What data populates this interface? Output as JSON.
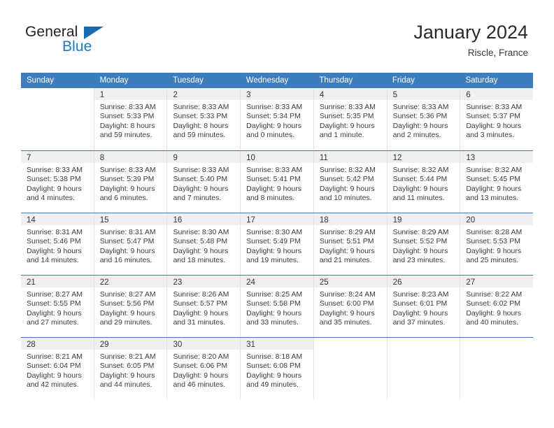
{
  "brand": {
    "name_part1": "General",
    "name_part2": "Blue",
    "triangle_color": "#1b6bb0",
    "blue_color": "#1f78c1"
  },
  "header": {
    "title": "January 2024",
    "location": "Riscle, France"
  },
  "theme": {
    "header_row_bg": "#3b7dbd",
    "day_number_bg": "#f0f0f0",
    "week_divider": "#3b7dbd",
    "column_divider": "#e3e3e3"
  },
  "weekday_headers": [
    "Sunday",
    "Monday",
    "Tuesday",
    "Wednesday",
    "Thursday",
    "Friday",
    "Saturday"
  ],
  "weeks": [
    [
      {
        "day": "",
        "sunrise": "",
        "sunset": "",
        "daylight_line1": "",
        "daylight_line2": ""
      },
      {
        "day": "1",
        "sunrise": "Sunrise: 8:33 AM",
        "sunset": "Sunset: 5:33 PM",
        "daylight_line1": "Daylight: 8 hours",
        "daylight_line2": "and 59 minutes."
      },
      {
        "day": "2",
        "sunrise": "Sunrise: 8:33 AM",
        "sunset": "Sunset: 5:33 PM",
        "daylight_line1": "Daylight: 8 hours",
        "daylight_line2": "and 59 minutes."
      },
      {
        "day": "3",
        "sunrise": "Sunrise: 8:33 AM",
        "sunset": "Sunset: 5:34 PM",
        "daylight_line1": "Daylight: 9 hours",
        "daylight_line2": "and 0 minutes."
      },
      {
        "day": "4",
        "sunrise": "Sunrise: 8:33 AM",
        "sunset": "Sunset: 5:35 PM",
        "daylight_line1": "Daylight: 9 hours",
        "daylight_line2": "and 1 minute."
      },
      {
        "day": "5",
        "sunrise": "Sunrise: 8:33 AM",
        "sunset": "Sunset: 5:36 PM",
        "daylight_line1": "Daylight: 9 hours",
        "daylight_line2": "and 2 minutes."
      },
      {
        "day": "6",
        "sunrise": "Sunrise: 8:33 AM",
        "sunset": "Sunset: 5:37 PM",
        "daylight_line1": "Daylight: 9 hours",
        "daylight_line2": "and 3 minutes."
      }
    ],
    [
      {
        "day": "7",
        "sunrise": "Sunrise: 8:33 AM",
        "sunset": "Sunset: 5:38 PM",
        "daylight_line1": "Daylight: 9 hours",
        "daylight_line2": "and 4 minutes."
      },
      {
        "day": "8",
        "sunrise": "Sunrise: 8:33 AM",
        "sunset": "Sunset: 5:39 PM",
        "daylight_line1": "Daylight: 9 hours",
        "daylight_line2": "and 6 minutes."
      },
      {
        "day": "9",
        "sunrise": "Sunrise: 8:33 AM",
        "sunset": "Sunset: 5:40 PM",
        "daylight_line1": "Daylight: 9 hours",
        "daylight_line2": "and 7 minutes."
      },
      {
        "day": "10",
        "sunrise": "Sunrise: 8:33 AM",
        "sunset": "Sunset: 5:41 PM",
        "daylight_line1": "Daylight: 9 hours",
        "daylight_line2": "and 8 minutes."
      },
      {
        "day": "11",
        "sunrise": "Sunrise: 8:32 AM",
        "sunset": "Sunset: 5:42 PM",
        "daylight_line1": "Daylight: 9 hours",
        "daylight_line2": "and 10 minutes."
      },
      {
        "day": "12",
        "sunrise": "Sunrise: 8:32 AM",
        "sunset": "Sunset: 5:44 PM",
        "daylight_line1": "Daylight: 9 hours",
        "daylight_line2": "and 11 minutes."
      },
      {
        "day": "13",
        "sunrise": "Sunrise: 8:32 AM",
        "sunset": "Sunset: 5:45 PM",
        "daylight_line1": "Daylight: 9 hours",
        "daylight_line2": "and 13 minutes."
      }
    ],
    [
      {
        "day": "14",
        "sunrise": "Sunrise: 8:31 AM",
        "sunset": "Sunset: 5:46 PM",
        "daylight_line1": "Daylight: 9 hours",
        "daylight_line2": "and 14 minutes."
      },
      {
        "day": "15",
        "sunrise": "Sunrise: 8:31 AM",
        "sunset": "Sunset: 5:47 PM",
        "daylight_line1": "Daylight: 9 hours",
        "daylight_line2": "and 16 minutes."
      },
      {
        "day": "16",
        "sunrise": "Sunrise: 8:30 AM",
        "sunset": "Sunset: 5:48 PM",
        "daylight_line1": "Daylight: 9 hours",
        "daylight_line2": "and 18 minutes."
      },
      {
        "day": "17",
        "sunrise": "Sunrise: 8:30 AM",
        "sunset": "Sunset: 5:49 PM",
        "daylight_line1": "Daylight: 9 hours",
        "daylight_line2": "and 19 minutes."
      },
      {
        "day": "18",
        "sunrise": "Sunrise: 8:29 AM",
        "sunset": "Sunset: 5:51 PM",
        "daylight_line1": "Daylight: 9 hours",
        "daylight_line2": "and 21 minutes."
      },
      {
        "day": "19",
        "sunrise": "Sunrise: 8:29 AM",
        "sunset": "Sunset: 5:52 PM",
        "daylight_line1": "Daylight: 9 hours",
        "daylight_line2": "and 23 minutes."
      },
      {
        "day": "20",
        "sunrise": "Sunrise: 8:28 AM",
        "sunset": "Sunset: 5:53 PM",
        "daylight_line1": "Daylight: 9 hours",
        "daylight_line2": "and 25 minutes."
      }
    ],
    [
      {
        "day": "21",
        "sunrise": "Sunrise: 8:27 AM",
        "sunset": "Sunset: 5:55 PM",
        "daylight_line1": "Daylight: 9 hours",
        "daylight_line2": "and 27 minutes."
      },
      {
        "day": "22",
        "sunrise": "Sunrise: 8:27 AM",
        "sunset": "Sunset: 5:56 PM",
        "daylight_line1": "Daylight: 9 hours",
        "daylight_line2": "and 29 minutes."
      },
      {
        "day": "23",
        "sunrise": "Sunrise: 8:26 AM",
        "sunset": "Sunset: 5:57 PM",
        "daylight_line1": "Daylight: 9 hours",
        "daylight_line2": "and 31 minutes."
      },
      {
        "day": "24",
        "sunrise": "Sunrise: 8:25 AM",
        "sunset": "Sunset: 5:58 PM",
        "daylight_line1": "Daylight: 9 hours",
        "daylight_line2": "and 33 minutes."
      },
      {
        "day": "25",
        "sunrise": "Sunrise: 8:24 AM",
        "sunset": "Sunset: 6:00 PM",
        "daylight_line1": "Daylight: 9 hours",
        "daylight_line2": "and 35 minutes."
      },
      {
        "day": "26",
        "sunrise": "Sunrise: 8:23 AM",
        "sunset": "Sunset: 6:01 PM",
        "daylight_line1": "Daylight: 9 hours",
        "daylight_line2": "and 37 minutes."
      },
      {
        "day": "27",
        "sunrise": "Sunrise: 8:22 AM",
        "sunset": "Sunset: 6:02 PM",
        "daylight_line1": "Daylight: 9 hours",
        "daylight_line2": "and 40 minutes."
      }
    ],
    [
      {
        "day": "28",
        "sunrise": "Sunrise: 8:21 AM",
        "sunset": "Sunset: 6:04 PM",
        "daylight_line1": "Daylight: 9 hours",
        "daylight_line2": "and 42 minutes."
      },
      {
        "day": "29",
        "sunrise": "Sunrise: 8:21 AM",
        "sunset": "Sunset: 6:05 PM",
        "daylight_line1": "Daylight: 9 hours",
        "daylight_line2": "and 44 minutes."
      },
      {
        "day": "30",
        "sunrise": "Sunrise: 8:20 AM",
        "sunset": "Sunset: 6:06 PM",
        "daylight_line1": "Daylight: 9 hours",
        "daylight_line2": "and 46 minutes."
      },
      {
        "day": "31",
        "sunrise": "Sunrise: 8:18 AM",
        "sunset": "Sunset: 6:08 PM",
        "daylight_line1": "Daylight: 9 hours",
        "daylight_line2": "and 49 minutes."
      },
      {
        "day": "",
        "sunrise": "",
        "sunset": "",
        "daylight_line1": "",
        "daylight_line2": ""
      },
      {
        "day": "",
        "sunrise": "",
        "sunset": "",
        "daylight_line1": "",
        "daylight_line2": ""
      },
      {
        "day": "",
        "sunrise": "",
        "sunset": "",
        "daylight_line1": "",
        "daylight_line2": ""
      }
    ]
  ]
}
